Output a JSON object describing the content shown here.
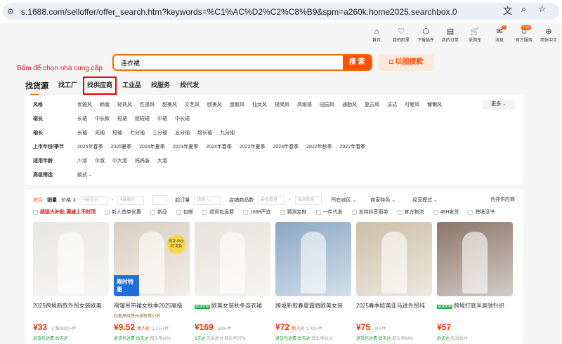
{
  "browser": {
    "url": "s.1688.com/selloffer/offer_search.htm?keywords=%C1%AC%D2%C2%C8%B9&spm=a260k.home2025.searchbox.0"
  },
  "topnav": [
    {
      "label": "首页",
      "icon": "⌂"
    },
    {
      "label": "我的阿里",
      "icon": "♡"
    },
    {
      "label": "下载插件",
      "icon": "⬡"
    },
    {
      "label": "我的订单",
      "icon": "▤"
    },
    {
      "label": "采购车",
      "icon": "🛒"
    },
    {
      "label": "消息",
      "icon": "✉",
      "badge": "5"
    },
    {
      "label": "官方服务",
      "icon": "☺",
      "badge": "开店"
    },
    {
      "label": "简体中文",
      "icon": "⊕"
    }
  ],
  "search": {
    "value": "连衣裙",
    "button": "搜 索",
    "image_search": "以图搜款"
  },
  "annotation": "Bấm để chọn nhà cung cấp",
  "tabs": [
    "找货源",
    "找工厂",
    "找供应商",
    "工业品",
    "找服务",
    "找代发"
  ],
  "filters": [
    {
      "label": "风格",
      "options": [
        "优雅风",
        "韩版",
        "轻熟风",
        "性感风",
        "甜美风",
        "文艺风",
        "欧美风",
        "度假风",
        "仙女风",
        "极简风",
        "高级感",
        "田园风",
        "通勤风",
        "复古风",
        "法式",
        "可爱风",
        "慵懒风"
      ]
    },
    {
      "label": "裙长",
      "options": [
        "长裙",
        "中长款",
        "短裙",
        "超短裙",
        "中裙",
        "中长裙"
      ]
    },
    {
      "label": "袖长",
      "options": [
        "长袖",
        "无袖",
        "短袖",
        "七分袖",
        "三分袖",
        "五分袖",
        "超长袖",
        "九分袖"
      ]
    },
    {
      "label": "上市年份/季节",
      "options": [
        "2025年春季",
        "2025夏季",
        "2024年夏季",
        "2023年夏季",
        "2024年春季",
        "2022年夏季",
        "2023年春季",
        "2022年秋季",
        "2022年春季"
      ]
    },
    {
      "label": "适用年龄",
      "options": [
        "少淑",
        "中淑",
        "中大淑",
        "妈妈装",
        "大淑"
      ]
    },
    {
      "label": "高级筛选",
      "options": [
        "款式 ⌄"
      ]
    }
  ],
  "more": "更多 ⌄",
  "sort": {
    "items": [
      "综合",
      "销量",
      "价格 ⇕"
    ],
    "price_min": "¥最低价",
    "price_max": "¥最高价",
    "moq_label": "起订量",
    "moq_ph": "请输入",
    "shop_count": "店铺商品数",
    "count_min": "最低数量",
    "count_max": "最高数量",
    "dropdowns": [
      "所在地区 ⌄",
      "商家特色 ⌄",
      "经营模式 ⌄"
    ],
    "merge": "合并供应商"
  },
  "checks": [
    "超级大补贴 满减上不封顶",
    "新人首单优惠",
    "新品",
    "包邮",
    "退货包运费",
    "1688严选",
    "猜测定制",
    "一件代发",
    "支持抖音面单",
    "官方物流",
    "48H发货",
    "跨境证书"
  ],
  "products": [
    {
      "title": "2025跨境新款外贸女装欧美",
      "tag": "",
      "sub": "",
      "price": "¥33",
      "nr": "",
      "sold": "已售9800+件",
      "svc": "退货包运费  后天达",
      "g": "",
      "img": "#e8e6e3"
    },
    {
      "title": "褶皱吊带裙女秋季2025高级",
      "tag": "",
      "sub": "轻奢高级感长裙榜第15名",
      "price": "¥9.52",
      "nr": "新人价",
      "sold": "1.2万+件",
      "svc": "退货包运费  后天达",
      "g": "回头率60%",
      "img": "#d8cfc2",
      "overlay": "限时特惠",
      "badge2": "现货 48小时 发货"
    },
    {
      "title": "欧美女装秋冬连衣裙",
      "tag": "猜测定制",
      "sub": "",
      "price": "¥169",
      "nr": "",
      "sold": "500+件",
      "svc": "3天达",
      "g": "先采后付  回头率37%",
      "img": "#e6e2dc"
    },
    {
      "title": "跨境新款春夏露肩欧美女装",
      "tag": "",
      "sub": "",
      "price": "¥72",
      "nr": "新人价",
      "sold": "1700+件",
      "svc": "退货包运费  后天达",
      "g": "回头率61%",
      "img": "#8ba7c4"
    },
    {
      "title": "2025春季欧美亚马逊外贸纯",
      "tag": "",
      "sub": "",
      "price": "¥75",
      "nr": "",
      "sold": "90+件",
      "svc": "退货包运费  后天达",
      "g": "回头率64%",
      "img": "#cdbfa8"
    },
    {
      "title": "跨境打底半高领针织",
      "tag": "猜测定制",
      "sub": "",
      "price": "¥57",
      "nr": "",
      "sold": "",
      "svc": "后天达",
      "g": "先采后付",
      "img": "#8c7468"
    }
  ]
}
